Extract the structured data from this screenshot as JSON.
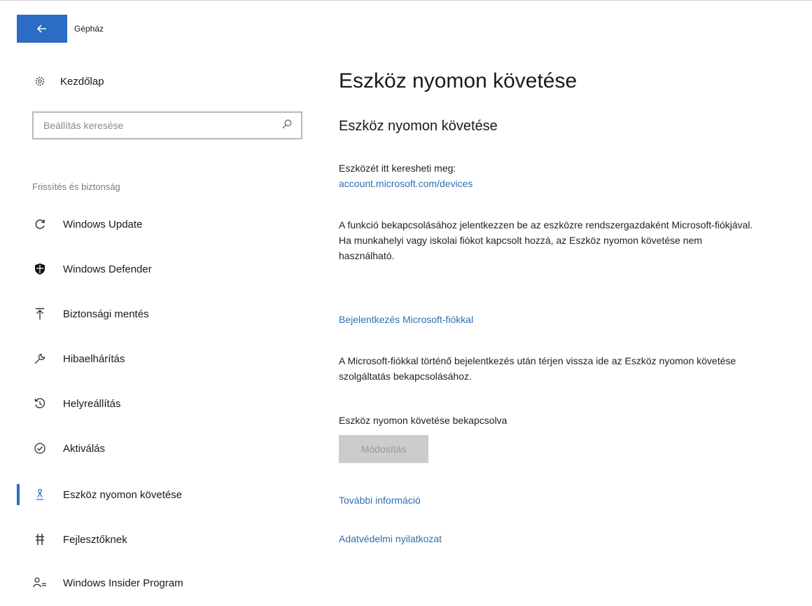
{
  "window": {
    "title": "Gépház",
    "accent": "#2b6cc4",
    "link_color": "#2c6fb3"
  },
  "sidebar": {
    "home": {
      "label": "Kezdőlap",
      "icon": "gear-icon"
    },
    "search": {
      "placeholder": "Beállítás keresése",
      "icon": "search-icon"
    },
    "section_header": "Frissítés és biztonság",
    "items": [
      {
        "label": "Windows Update",
        "icon": "sync-icon"
      },
      {
        "label": "Windows Defender",
        "icon": "shield-icon"
      },
      {
        "label": "Biztonsági mentés",
        "icon": "upload-icon"
      },
      {
        "label": "Hibaelhárítás",
        "icon": "wrench-icon"
      },
      {
        "label": "Helyreállítás",
        "icon": "history-icon"
      },
      {
        "label": "Aktiválás",
        "icon": "check-circle-icon"
      },
      {
        "label": "Eszköz nyomon követése",
        "icon": "person-locate-icon",
        "active": true
      },
      {
        "label": "Fejlesztőknek",
        "icon": "developer-icon"
      },
      {
        "label": "Windows Insider Program",
        "icon": "insider-icon"
      }
    ]
  },
  "content": {
    "page_title": "Eszköz nyomon követése",
    "section_title": "Eszköz nyomon követése",
    "find_device_text": "Eszközét itt keresheti meg:",
    "find_device_link": "account.microsoft.com/devices",
    "description": "A funkció bekapcsolásához jelentkezzen be az eszközre rendszergazdaként Microsoft-fiókjával. Ha munkahelyi vagy iskolai fiókot kapcsolt hozzá, az Eszköz nyomon követése nem használható.",
    "signin_link": "Bejelentkezés Microsoft-fiókkal",
    "after_signin_text": "A Microsoft-fiókkal történő bejelentkezés után térjen vissza ide az Eszköz nyomon követése szolgáltatás bekapcsolásához.",
    "status_text": "Eszköz nyomon követése bekapcsolva",
    "modify_button": "Módosítás",
    "more_info_link": "További információ",
    "privacy_link": "Adatvédelmi nyilatkozat"
  }
}
